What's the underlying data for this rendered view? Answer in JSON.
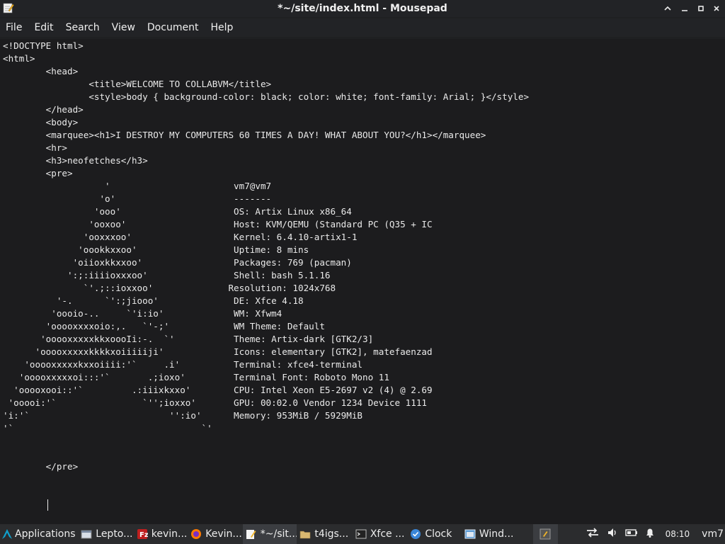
{
  "window": {
    "title": "*~/site/index.html - Mousepad",
    "controls": {
      "minimize": "^",
      "restore": "–",
      "maximize": "▫",
      "close": "×"
    }
  },
  "menu": [
    "File",
    "Edit",
    "Search",
    "View",
    "Document",
    "Help"
  ],
  "editor": {
    "lines": [
      "<!DOCTYPE html>",
      "<html>",
      "        <head>",
      "                <title>WELCOME TO COLLABVM</title>",
      "                <style>body { background-color: black; color: white; font-family: Arial; }</style>",
      "        </head>",
      "        <body>",
      "        <marquee><h1>I DESTROY MY COMPUTERS 60 TIMES A DAY! WHAT ABOUT YOU?</h1></marquee>",
      "        <hr>",
      "        <h3>neofetches</h3>",
      "        <pre>",
      "                   '                       vm7@vm7",
      "                  'o'                      -------",
      "                 'ooo'                     OS: Artix Linux x86_64",
      "                'ooxoo'                    Host: KVM/QEMU (Standard PC (Q35 + IC",
      "               'ooxxxoo'                   Kernel: 6.4.10-artix1-1",
      "              'oookkxxoo'                  Uptime: 8 mins",
      "             'oiioxkkxxoo'                 Packages: 769 (pacman)",
      "            ':;:iiiioxxxoo'                Shell: bash 5.1.16",
      "               `'.;::ioxxoo'              Resolution: 1024x768",
      "          '-.      `':;jiooo'              DE: Xfce 4.18",
      "         'oooio-..     `'i:io'             WM: Xfwm4",
      "        'ooooxxxxoio:,.   `'-;'            WM Theme: Default",
      "       'ooooxxxxxkkxoooIi:-.  `'           Theme: Artix-dark [GTK2/3]",
      "      'ooooxxxxxkkkkxoiiiiiji'             Icons: elementary [GTK2], matefaenzad",
      "    'ooooxxxxxkxxoiiii:'`     .i'          Terminal: xfce4-terminal",
      "   'ooooxxxxxoi:::'`       .;ioxo'         Terminal Font: Roboto Mono 11",
      "  'ooooxooi::'`         .:iiixkxxo'        CPU: Intel Xeon E5-2697 v2 (4) @ 2.69",
      " 'ooooi:'`                `'';ioxxo'       GPU: 00:02.0 Vendor 1234 Device 1111",
      "'i:'`                          '':io'      Memory: 953MiB / 5929MiB",
      "'`                                   `'",
      "",
      "",
      "        </pre>"
    ]
  },
  "taskbar": {
    "start_label": "Applications",
    "items": [
      {
        "label": "Lepto...",
        "icon": "window-icon",
        "color": "#cfd6df"
      },
      {
        "label": "kevin...",
        "icon": "filezilla-icon",
        "color": "#c0392b"
      },
      {
        "label": "Kevin...",
        "icon": "firefox-icon",
        "color": "#e66000"
      },
      {
        "label": "*~/sit...",
        "icon": "mousepad-icon",
        "color": "#e8d34a"
      },
      {
        "label": "t4igs...",
        "icon": "folder-icon",
        "color": "#d9b870"
      },
      {
        "label": "Xfce ...",
        "icon": "terminal-icon",
        "color": "#444"
      },
      {
        "label": "Clock",
        "icon": "clock-icon",
        "color": "#3a86d8"
      },
      {
        "label": "Wind...",
        "icon": "window-icon",
        "color": "#5b9bd5"
      }
    ],
    "clock": "08:10",
    "user": "vm7"
  }
}
